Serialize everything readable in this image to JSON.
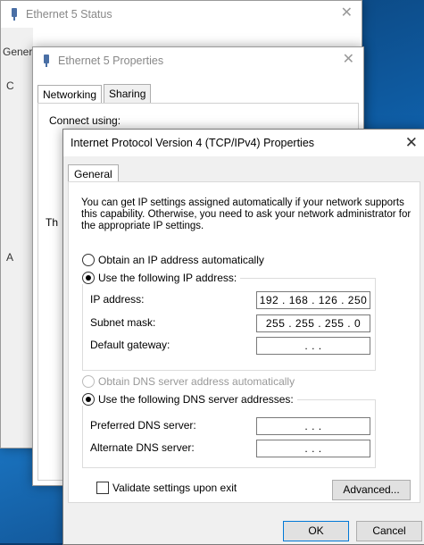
{
  "window1": {
    "title": "Ethernet 5 Status",
    "tab_label": "General",
    "fragments": [
      "C",
      "A"
    ]
  },
  "window2": {
    "title": "Ethernet 5 Properties",
    "tabs": [
      "Networking",
      "Sharing"
    ],
    "connect_using": "Connect using:",
    "fragment": "Th"
  },
  "dialog": {
    "title": "Internet Protocol Version 4 (TCP/IPv4) Properties",
    "tab": "General",
    "description": "You can get IP settings assigned automatically if your network supports this capability. Otherwise, you need to ask your network administrator for the appropriate IP settings.",
    "ip_auto_label": "Obtain an IP address automatically",
    "ip_manual_label": "Use the following IP address:",
    "ip_address_label": "IP address:",
    "ip_address_value": "192 . 168 . 126 . 250",
    "subnet_label": "Subnet mask:",
    "subnet_value": "255 . 255 . 255 .  0",
    "gateway_label": "Default gateway:",
    "gateway_value": ".     .     .",
    "dns_auto_label": "Obtain DNS server address automatically",
    "dns_manual_label": "Use the following DNS server addresses:",
    "preferred_dns_label": "Preferred DNS server:",
    "preferred_dns_value": ".     .     .",
    "alternate_dns_label": "Alternate DNS server:",
    "alternate_dns_value": ".     .     .",
    "validate_label": "Validate settings upon exit",
    "advanced_label": "Advanced...",
    "ok_label": "OK",
    "cancel_label": "Cancel",
    "close_glyph": "✕"
  },
  "colors": {
    "accent": "#0078d7",
    "desktop": "#0f5fa8"
  }
}
